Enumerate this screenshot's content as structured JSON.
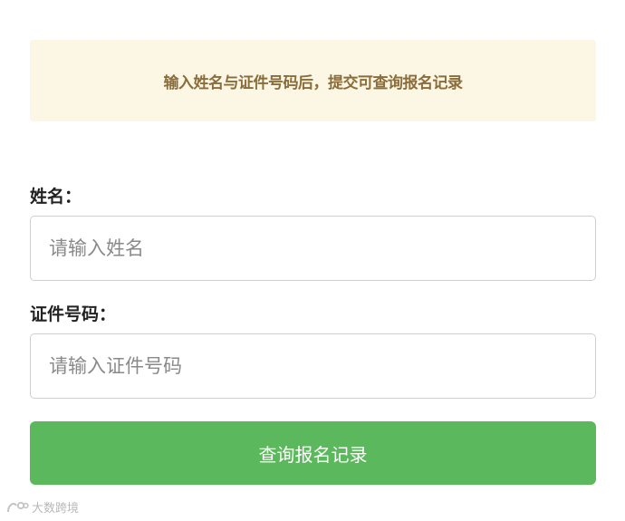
{
  "notice": {
    "text": "输入姓名与证件号码后，提交可查询报名记录"
  },
  "form": {
    "name_label": "姓名：",
    "name_placeholder": "请输入姓名",
    "name_value": "",
    "id_label": "证件号码：",
    "id_placeholder": "请输入证件号码",
    "id_value": "",
    "submit_label": "查询报名记录"
  },
  "watermark": {
    "text": "大数跨境"
  },
  "colors": {
    "notice_bg": "#fcf7e4",
    "notice_text": "#8a6d3b",
    "button": "#5cb85c"
  }
}
